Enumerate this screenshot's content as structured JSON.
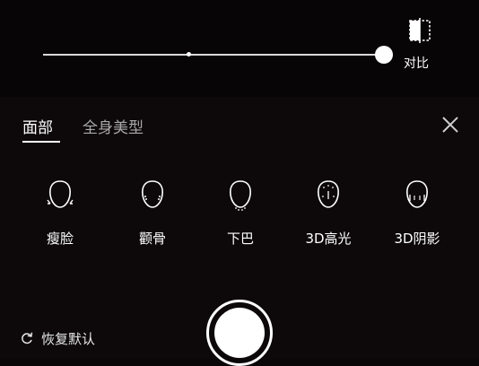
{
  "adjust": {
    "compare_label": "对比",
    "slider_value": 1.0
  },
  "tabs": [
    {
      "label": "面部",
      "active": true
    },
    {
      "label": "全身美型",
      "active": false
    }
  ],
  "tools": [
    {
      "label": "瘦脸",
      "icon": "slim-face-icon"
    },
    {
      "label": "颧骨",
      "icon": "cheekbone-icon"
    },
    {
      "label": "下巴",
      "icon": "chin-icon"
    },
    {
      "label": "3D高光",
      "icon": "3d-highlight-icon"
    },
    {
      "label": "3D阴影",
      "icon": "3d-shadow-icon"
    }
  ],
  "footer": {
    "reset_label": "恢复默认"
  },
  "colors": {
    "background": "#0d090a",
    "accent": "#ffffff",
    "inactive_text": "#a9a9a9"
  }
}
